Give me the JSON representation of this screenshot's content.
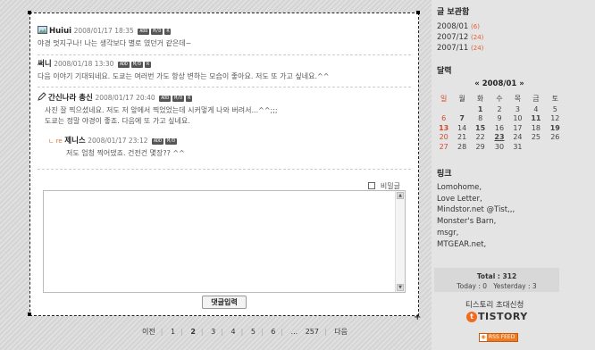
{
  "comments": [
    {
      "name": "Huiui",
      "date": "2008/01/17 18:35",
      "body": "야경 멋지구나! 나는 생각보다 별로 였던거 같은데~",
      "has_icon": true
    },
    {
      "name": "써니",
      "date": "2008/01/18 13:30",
      "body": "다음 이야기 기대되네요. 도쿄는 여러번 가도 항상 변하는 모습이 좋아요. 저도 또 가고 싶네요.^^",
      "has_icon": false
    },
    {
      "name": "간신나라 총신",
      "date": "2008/01/17 20:40",
      "body": "사진 잘 찍으셨네요. 저도 저 앞에서 찍었었는데 시커멓게 나와 버려서...^^;;;",
      "body2": "도쿄는 정말 야경이 좋죠. 다음에 또 가고 싶네요.",
      "has_icon": true
    }
  ],
  "reply": {
    "arrow": "ㄴ re",
    "name": "제니스",
    "date": "2008/01/17 23:12",
    "body": "저도 엄청 찍어댔죠. 건전건 몇장??  ^^"
  },
  "buttons": {
    "add": "ADD",
    "mod": "M/D",
    "reply": "R"
  },
  "form": {
    "secret_label": "비밀글",
    "submit_label": "댓글입력",
    "textarea_value": ""
  },
  "pager": {
    "prev": "이전",
    "pages": [
      "1",
      "2",
      "3",
      "4",
      "5",
      "6"
    ],
    "current": "2",
    "ellipsis": "...",
    "last": "257",
    "next": "다음"
  },
  "sidebar": {
    "archive_title": "글 보관함",
    "archive": [
      {
        "month": "2008/01",
        "count": "(6)"
      },
      {
        "month": "2007/12",
        "count": "(24)"
      },
      {
        "month": "2007/11",
        "count": "(24)"
      }
    ],
    "calendar_title": "달력",
    "calendar_month": "« 2008/01 »",
    "weekdays": [
      "일",
      "월",
      "화",
      "수",
      "목",
      "금",
      "토"
    ],
    "weeks": [
      [
        "",
        "",
        "1",
        "2",
        "3",
        "4",
        "5"
      ],
      [
        "6",
        "7",
        "8",
        "9",
        "10",
        "11",
        "12"
      ],
      [
        "13",
        "14",
        "15",
        "16",
        "17",
        "18",
        "19"
      ],
      [
        "20",
        "21",
        "22",
        "23",
        "24",
        "25",
        "26"
      ],
      [
        "27",
        "28",
        "29",
        "30",
        "31",
        "",
        ""
      ]
    ],
    "links_title": "링크",
    "links": [
      "Lomohome,",
      "Love Letter,",
      "Mindstor.net @Tist,,,",
      "Monster's Barn,",
      "msgr,",
      "MTGEAR.net,"
    ],
    "total": "Total : 312",
    "today_yesterday": "Today : 0   Yesterday : 3",
    "invite": "티스토리 초대신청",
    "logo_text": "TISTORY",
    "logo_mark": "t",
    "rss": "RSS FEED"
  }
}
